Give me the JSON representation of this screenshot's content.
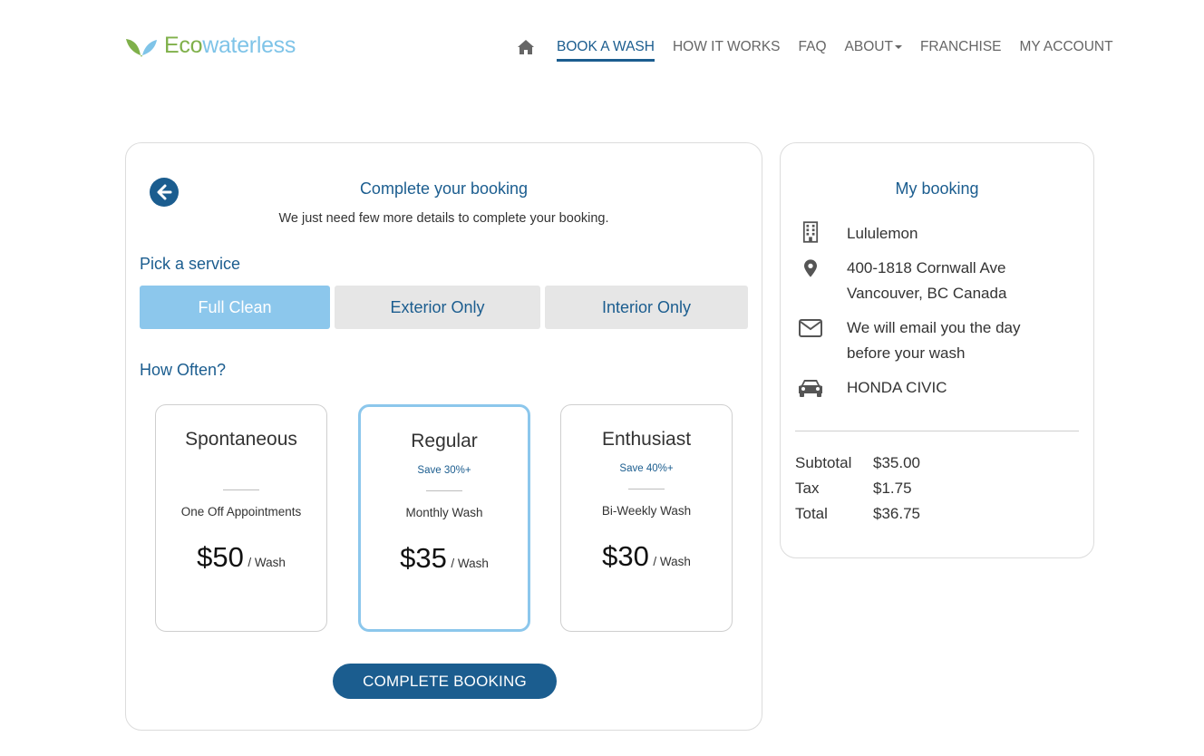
{
  "brand": {
    "logo_eco": "Eco",
    "logo_rest": "waterless",
    "colors": {
      "primary": "#1b5d8f",
      "accent": "#8cc7ec",
      "leaf": "#7fb04a"
    }
  },
  "nav": {
    "home_icon": "home-icon",
    "items": [
      {
        "label": "BOOK A WASH",
        "active": true
      },
      {
        "label": "HOW IT WORKS"
      },
      {
        "label": "FAQ"
      },
      {
        "label": "ABOUT"
      },
      {
        "label": "FRANCHISE"
      },
      {
        "label": "MY ACCOUNT"
      }
    ]
  },
  "booking": {
    "title": "Complete your booking",
    "subtitle": "We just need few more details to complete your booking.",
    "service_label": "Pick a service",
    "services": [
      {
        "label": "Full Clean",
        "selected": true
      },
      {
        "label": "Exterior Only"
      },
      {
        "label": "Interior Only"
      }
    ],
    "frequency_label": "How Often?",
    "plans": [
      {
        "name": "Spontaneous",
        "save": "",
        "desc": "One Off Appointments",
        "price": "$50",
        "unit": "/ Wash"
      },
      {
        "name": "Regular",
        "save": "Save 30%+",
        "desc": "Monthly Wash",
        "price": "$35",
        "unit": "/ Wash",
        "selected": true
      },
      {
        "name": "Enthusiast",
        "save": "Save 40%+",
        "desc": "Bi-Weekly Wash",
        "price": "$30",
        "unit": "/ Wash"
      }
    ],
    "complete_label": "COMPLETE BOOKING"
  },
  "summary": {
    "title": "My booking",
    "location_name": "Lululemon",
    "address_line1": "400-1818 Cornwall Ave",
    "address_line2": "Vancouver, BC Canada",
    "email_line1": "We will email you the day",
    "email_line2": "before your wash",
    "vehicle": "HONDA CIVIC",
    "subtotal_label": "Subtotal",
    "subtotal": "$35.00",
    "tax_label": "Tax",
    "tax": "$1.75",
    "total_label": "Total",
    "total": "$36.75"
  }
}
